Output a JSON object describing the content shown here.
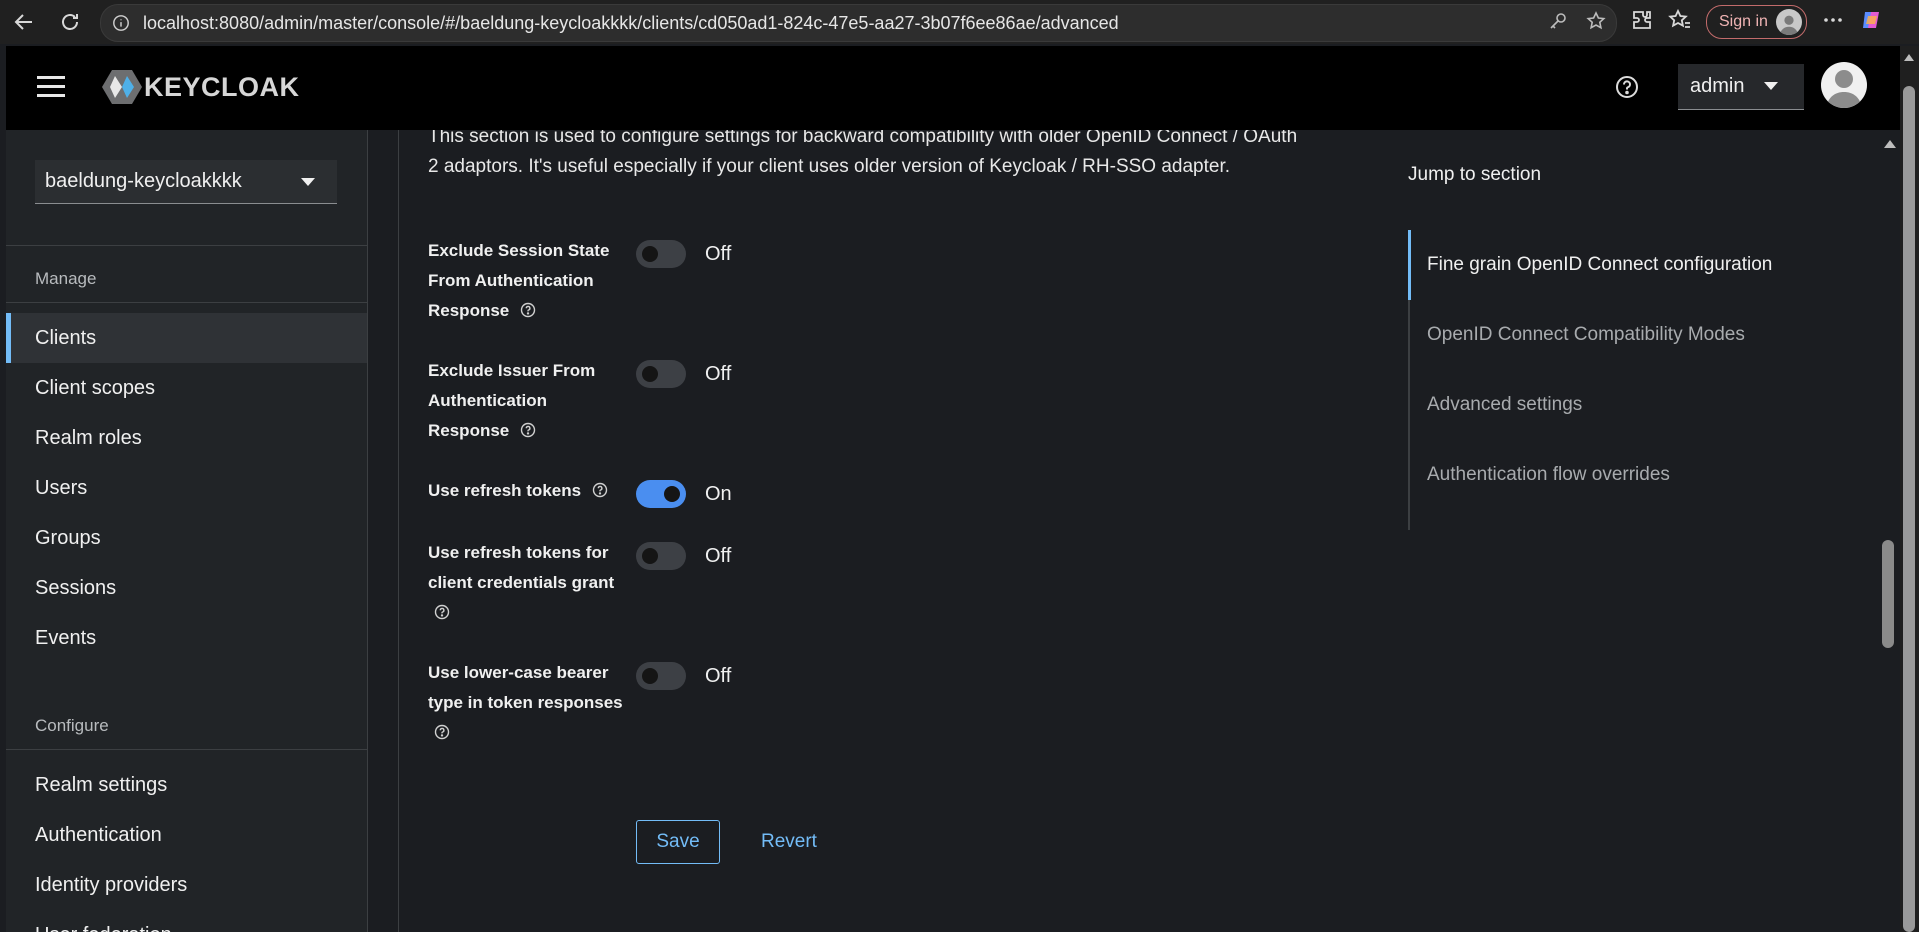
{
  "browser": {
    "url": "localhost:8080/admin/master/console/#/baeldung-keycloakkkk/clients/cd050ad1-824c-47e5-aa27-3b07f6ee86ae/advanced",
    "sign_in_label": "Sign in"
  },
  "header": {
    "logo_text": "KEYCLOAK",
    "user_label": "admin"
  },
  "sidebar": {
    "realm": "baeldung-keycloakkkk",
    "sections": {
      "manage": "Manage",
      "configure": "Configure"
    },
    "manage_items": [
      {
        "label": "Clients",
        "active": true
      },
      {
        "label": "Client scopes"
      },
      {
        "label": "Realm roles"
      },
      {
        "label": "Users"
      },
      {
        "label": "Groups"
      },
      {
        "label": "Sessions"
      },
      {
        "label": "Events"
      }
    ],
    "configure_items": [
      {
        "label": "Realm settings"
      },
      {
        "label": "Authentication"
      },
      {
        "label": "Identity providers"
      },
      {
        "label": "User federation"
      }
    ]
  },
  "main": {
    "description": "This section is used to configure settings for backward compatibility with older OpenID Connect / OAuth 2 adaptors. It's useful especially if your client uses older version of Keycloak / RH-SSO adapter.",
    "fields": [
      {
        "label": "Exclude Session State From Authentication Response",
        "state": "Off",
        "enabled": false
      },
      {
        "label": "Exclude Issuer From Authentication Response",
        "state": "Off",
        "enabled": false
      },
      {
        "label": "Use refresh tokens",
        "state": "On",
        "enabled": true
      },
      {
        "label": "Use refresh tokens for client credentials grant",
        "state": "Off",
        "enabled": false
      },
      {
        "label": "Use lower-case bearer type in token responses",
        "state": "Off",
        "enabled": false
      }
    ],
    "save_label": "Save",
    "revert_label": "Revert"
  },
  "jump": {
    "title": "Jump to section",
    "items": [
      {
        "label": "Fine grain OpenID Connect configuration",
        "active": true
      },
      {
        "label": "OpenID Connect Compatibility Modes"
      },
      {
        "label": "Advanced settings"
      },
      {
        "label": "Authentication flow overrides"
      }
    ]
  },
  "colors": {
    "accent": "#73bcf7",
    "toggle_on": "#4a8ef0",
    "header_bg": "#000000",
    "page_bg": "#1b1d21"
  }
}
